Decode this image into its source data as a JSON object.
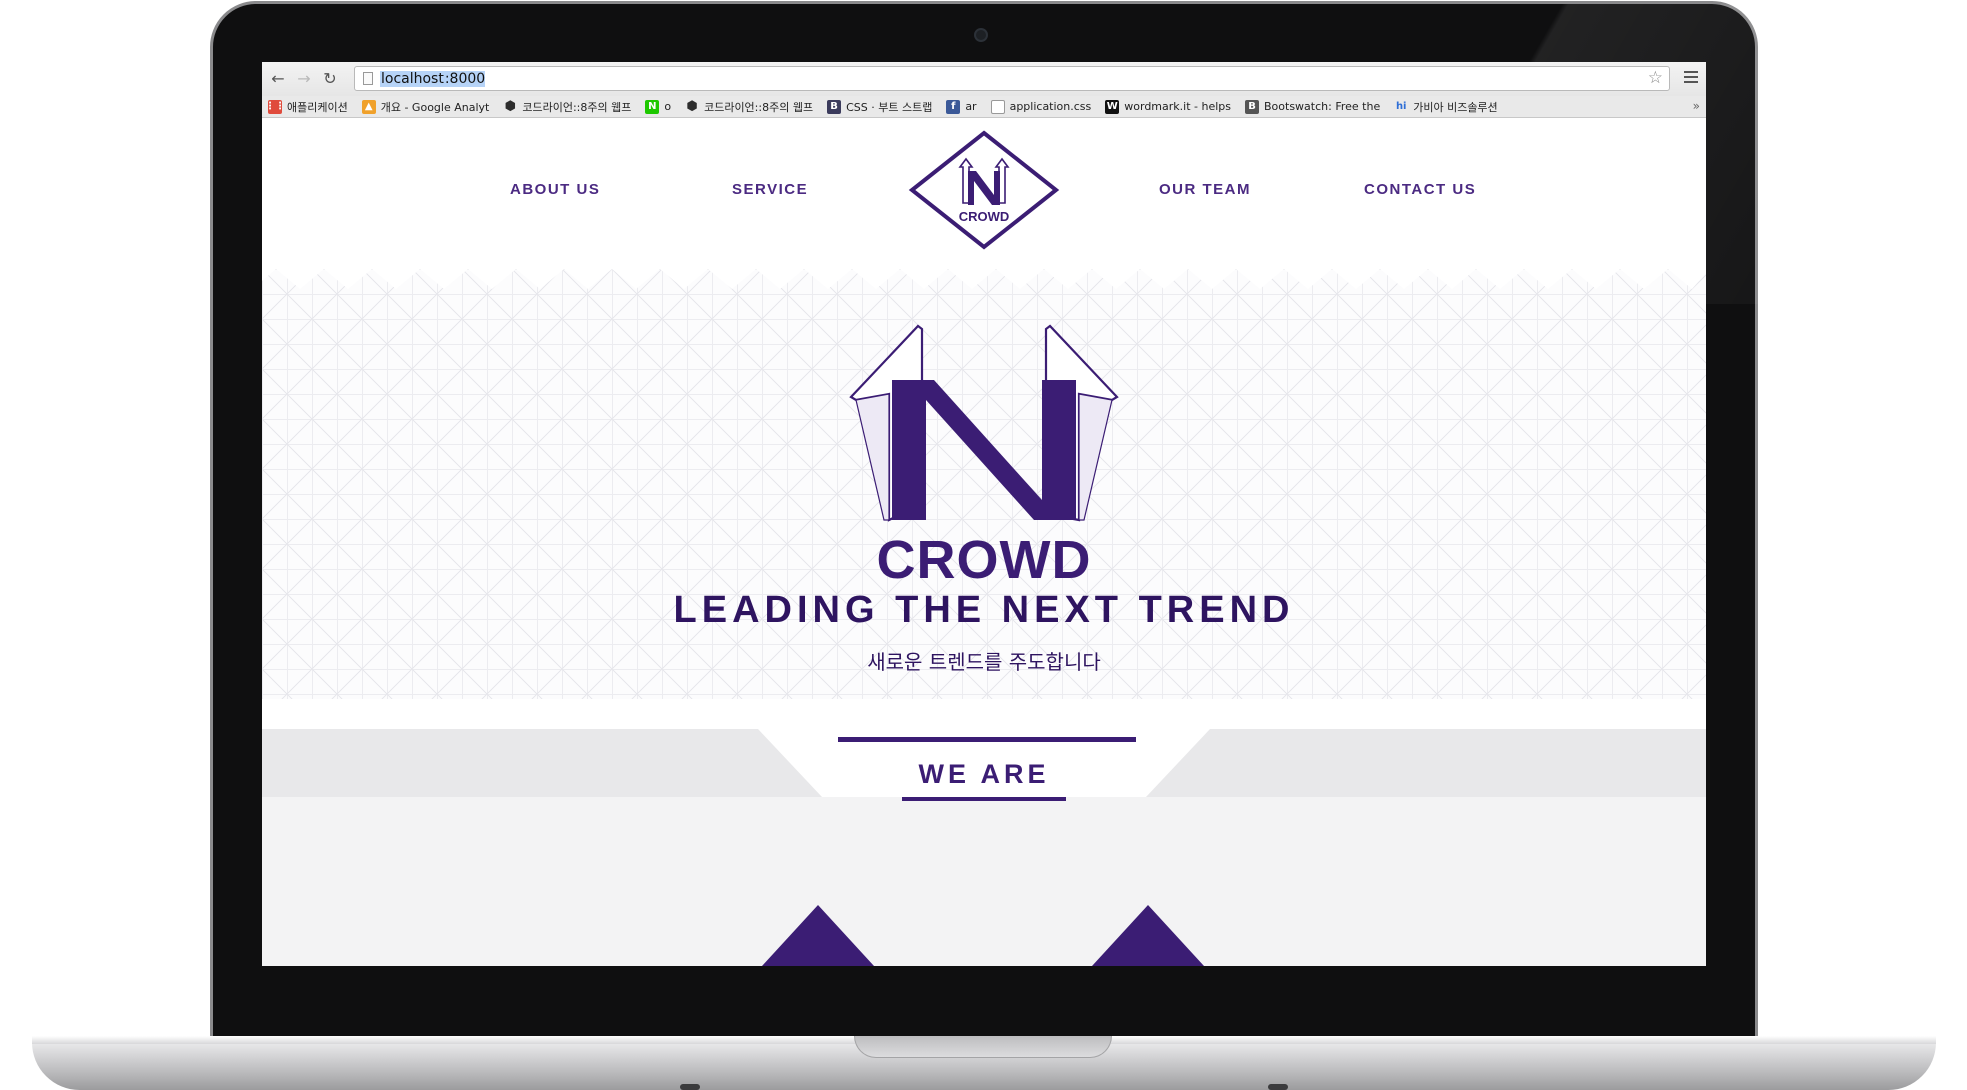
{
  "browser": {
    "url_host": "localhost",
    "url_port": ":8000",
    "bookmarks": [
      {
        "label": "애플리케이션",
        "icon": "apps-grid-icon",
        "color": "#e04b3c"
      },
      {
        "label": "개요 - Google Analyt",
        "icon": "analytics-icon",
        "color": "#f0a12b"
      },
      {
        "label": "코드라이언::8주의 웹프",
        "icon": "hexagon-icon",
        "color": "#2d2d2d"
      },
      {
        "label": "o",
        "icon": "naver-n-icon",
        "color": "#1ec800"
      },
      {
        "label": "코드라이언::8주의 웹프",
        "icon": "hexagon-icon",
        "color": "#2d2d2d"
      },
      {
        "label": "CSS · 부트 스트랩",
        "icon": "bootstrap-b-icon",
        "color": "#3b3b5c"
      },
      {
        "label": "ar",
        "icon": "facebook-icon",
        "color": "#3b5998"
      },
      {
        "label": "application.css",
        "icon": "file-icon",
        "color": "#ffffff"
      },
      {
        "label": "wordmark.it - helps",
        "icon": "wordmark-w-icon",
        "color": "#111111"
      },
      {
        "label": "Bootswatch: Free the",
        "icon": "bootswatch-b-icon",
        "color": "#555555"
      },
      {
        "label": "가비아 비즈솔루션",
        "icon": "gabia-hi-icon",
        "color": "#2f6fd6"
      }
    ]
  },
  "site": {
    "nav": {
      "about": "ABOUT US",
      "service": "SERVICE",
      "team": "OUR TEAM",
      "contact": "CONTACT US"
    },
    "logo_small_word": "CROWD",
    "logo_big_word": "CROWD",
    "tagline": "LEADING THE NEXT TREND",
    "subtagline": "새로운 트렌드를 주도합니다",
    "section_title": "WE ARE"
  },
  "colors": {
    "brand_purple": "#3b1d74",
    "nav_purple": "#4b2a82"
  }
}
